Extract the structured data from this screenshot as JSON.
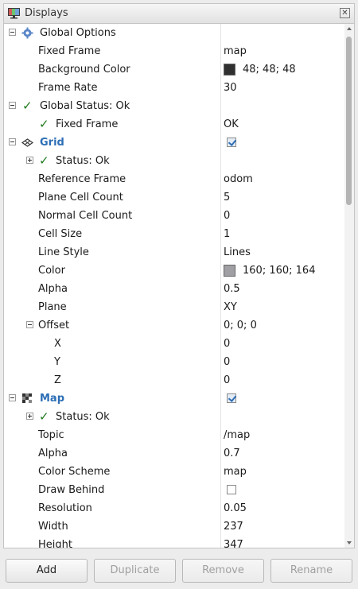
{
  "panel": {
    "title": "Displays",
    "close_glyph": "✕"
  },
  "icons": {
    "check_glyph": "✓"
  },
  "colors": {
    "background_color_swatch": "#303030",
    "grid_color_swatch": "#a0a0a4",
    "display_name_color": "#2c6eb5",
    "status_ok_color": "#1e7a1e"
  },
  "tree": {
    "global_options": {
      "label": "Global Options",
      "fixed_frame": {
        "name": "Fixed Frame",
        "value": "map"
      },
      "background_color": {
        "name": "Background Color",
        "value": "48; 48; 48"
      },
      "frame_rate": {
        "name": "Frame Rate",
        "value": "30"
      }
    },
    "global_status": {
      "label": "Global Status: Ok",
      "fixed_frame": {
        "name": "Fixed Frame",
        "value": "OK"
      }
    },
    "grid": {
      "label": "Grid",
      "enabled": true,
      "status": "Status: Ok",
      "reference_frame": {
        "name": "Reference Frame",
        "value": "odom"
      },
      "plane_cell_count": {
        "name": "Plane Cell Count",
        "value": "5"
      },
      "normal_cell_count": {
        "name": "Normal Cell Count",
        "value": "0"
      },
      "cell_size": {
        "name": "Cell Size",
        "value": "1"
      },
      "line_style": {
        "name": "Line Style",
        "value": "Lines"
      },
      "color": {
        "name": "Color",
        "value": "160; 160; 164"
      },
      "alpha": {
        "name": "Alpha",
        "value": "0.5"
      },
      "plane": {
        "name": "Plane",
        "value": "XY"
      },
      "offset": {
        "name": "Offset",
        "value": "0; 0; 0",
        "x": {
          "name": "X",
          "value": "0"
        },
        "y": {
          "name": "Y",
          "value": "0"
        },
        "z": {
          "name": "Z",
          "value": "0"
        }
      }
    },
    "map": {
      "label": "Map",
      "enabled": true,
      "status": "Status: Ok",
      "topic": {
        "name": "Topic",
        "value": "/map"
      },
      "alpha": {
        "name": "Alpha",
        "value": "0.7"
      },
      "color_scheme": {
        "name": "Color Scheme",
        "value": "map"
      },
      "draw_behind": {
        "name": "Draw Behind",
        "checked": false
      },
      "resolution": {
        "name": "Resolution",
        "value": "0.05"
      },
      "width": {
        "name": "Width",
        "value": "237"
      },
      "height": {
        "name": "Height",
        "value": "347"
      }
    }
  },
  "buttons": {
    "add": "Add",
    "duplicate": "Duplicate",
    "remove": "Remove",
    "rename": "Rename"
  }
}
